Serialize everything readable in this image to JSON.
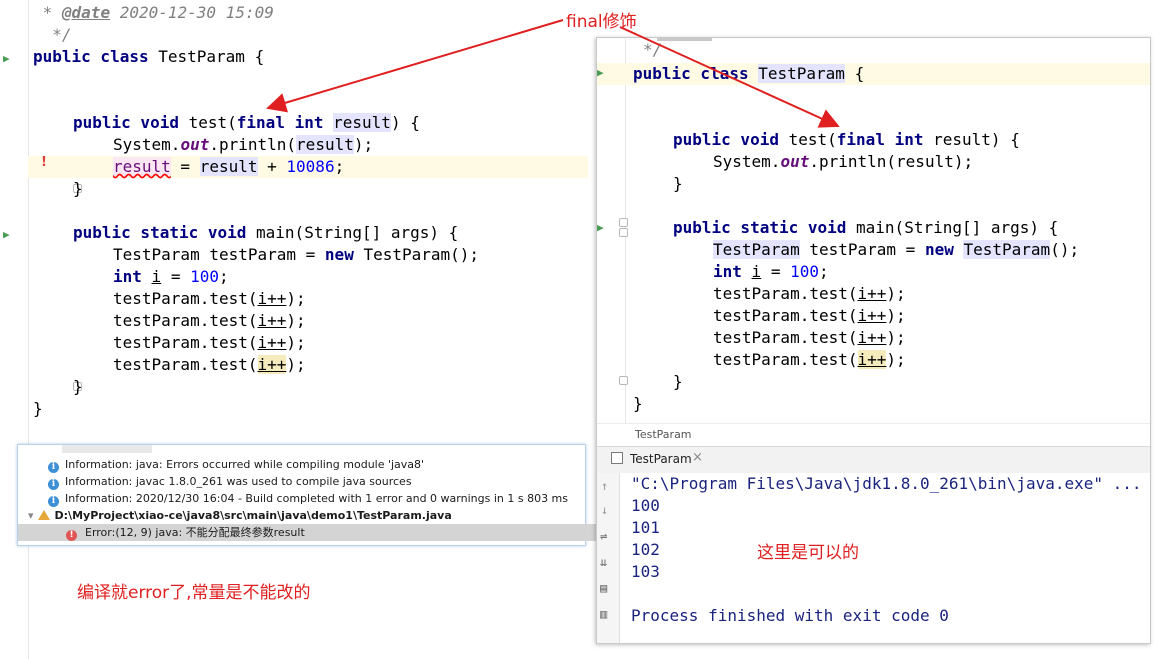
{
  "left_editor": {
    "line_date": "  * @date 2020-12-30 15:09",
    "date_tag": "@date",
    "date_value": "2020-12-30 15:09",
    "line_close_comment": "  */",
    "class_decl": {
      "kw": "public class",
      "name": "TestParam",
      "brace": "{"
    },
    "test_method": {
      "kw": "public void",
      "name": "test(",
      "final": "final",
      "int": "int",
      "param": "result",
      "rest": ") {"
    },
    "println": {
      "pre": "System.",
      "field": "out",
      "post": ".println(",
      "arg": "result",
      "end": ");"
    },
    "assign": {
      "lhs": "result",
      "eq": " = ",
      "rhs": "result",
      "plus": " + ",
      "num": "10086",
      "end": ";"
    },
    "close_brace_inner": "}",
    "main_method": {
      "kw": "public static void",
      "rest": " main(String[] args) {"
    },
    "new_line": {
      "pre": "TestParam testParam = ",
      "kw": "new",
      "post": " TestParam();"
    },
    "int_line": {
      "kw": "int",
      "var": "i",
      "eq": " = ",
      "num": "100",
      "end": ";"
    },
    "call_prefix": "testParam.test(",
    "call_var": "i++",
    "call_end": ");",
    "close_brace_outer": "}"
  },
  "build_panel": {
    "rows": [
      "Information: java: Errors occurred while compiling module 'java8'",
      "Information: javac 1.8.0_261 was used to compile java sources",
      "Information: 2020/12/30 16:04 - Build completed with 1 error and 0 warnings in 1 s 803 ms"
    ],
    "file_path": "D:\\MyProject\\xiao-ce\\java8\\src\\main\\java\\demo1\\TestParam.java",
    "error_row": "Error:(12, 9)  java: 不能分配最终参数result"
  },
  "annotations": {
    "top_label": "final修饰",
    "left_label": "编译就error了,常量是不能改的",
    "right_label": "这里是可以的"
  },
  "right_editor": {
    "close_comment": "*/",
    "class_decl": {
      "kw": "public class",
      "name": "TestParam",
      "brace": "{"
    },
    "test_method": {
      "kw": "public void",
      "name": "test(",
      "final": "final",
      "int": "int",
      "rest": " result) {"
    },
    "println": {
      "pre": "System.",
      "field": "out",
      "post": ".println(result);"
    },
    "close_brace_inner": "}",
    "main_method": {
      "kw": "public static void",
      "rest": " main(String[] args) {"
    },
    "new_line": {
      "type": "TestParam",
      "mid": " testParam = ",
      "kw": "new",
      "ctor": "TestParam",
      "end": "();"
    },
    "int_line": {
      "kw": "int",
      "var": "i",
      "eq": " = ",
      "num": "100",
      "end": ";"
    },
    "call_prefix": "testParam.test(",
    "call_var": "i++",
    "call_end": ");",
    "close_brace_outer": "}",
    "breadcrumb": "TestParam"
  },
  "run_panel": {
    "tab_label": "TestParam",
    "close_glyph": "×",
    "console_lines": [
      "\"C:\\Program Files\\Java\\jdk1.8.0_261\\bin\\java.exe\" ...",
      "100",
      "101",
      "102",
      "103",
      "",
      "Process finished with exit code 0"
    ]
  },
  "colors": {
    "keyword": "#000080",
    "number": "#0000ff",
    "field": "#660e7a",
    "comment": "#808080",
    "annotation_red": "#e02020",
    "console_text": "#1a237e"
  }
}
